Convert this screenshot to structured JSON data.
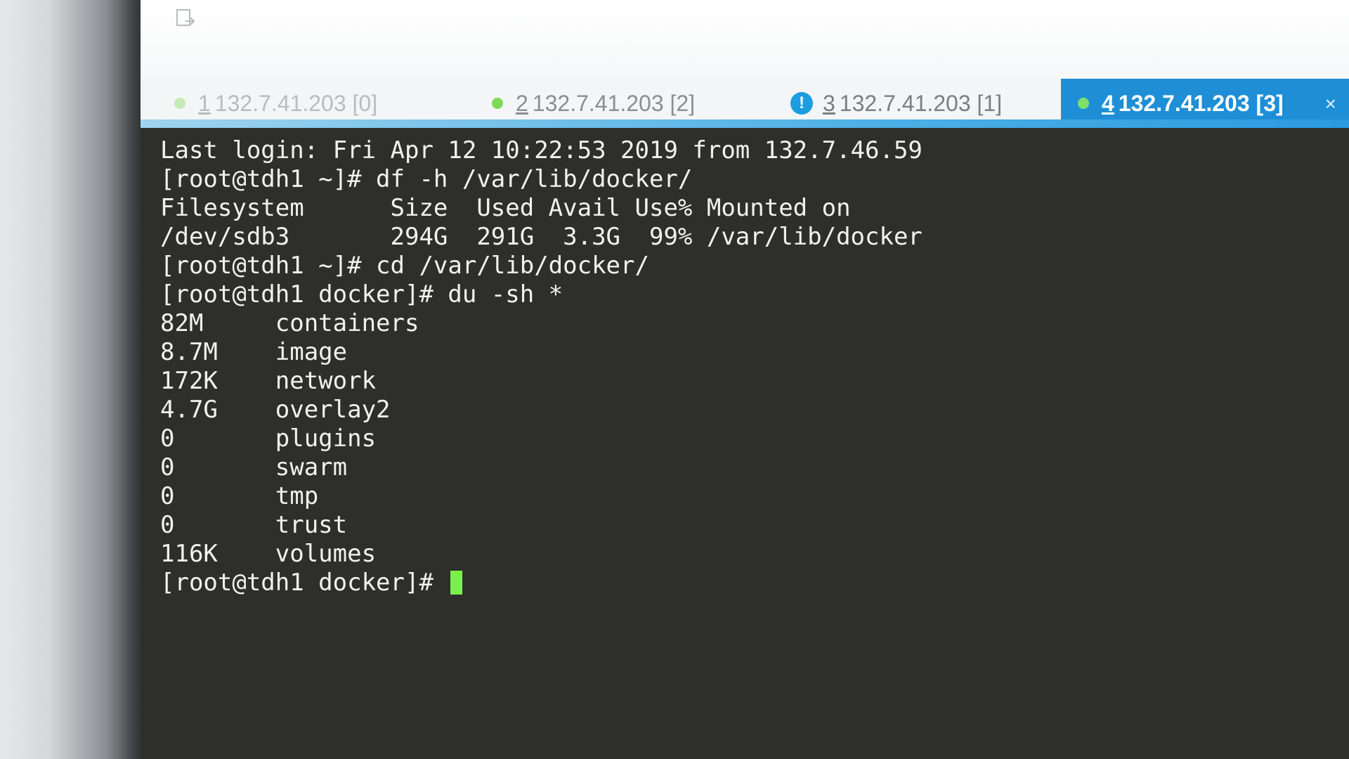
{
  "tabs": [
    {
      "num": "1",
      "label": "132.7.41.203 [0]",
      "status": "connected"
    },
    {
      "num": "2",
      "label": "132.7.41.203 [2]",
      "status": "connected"
    },
    {
      "num": "3",
      "label": "132.7.41.203 [1]",
      "status": "warning"
    },
    {
      "num": "4",
      "label": "132.7.41.203 [3]",
      "status": "connected",
      "active": true,
      "close": "×"
    }
  ],
  "terminal": {
    "lines": [
      "Last login: Fri Apr 12 10:22:53 2019 from 132.7.46.59",
      "[root@tdh1 ~]# df -h /var/lib/docker/",
      "Filesystem      Size  Used Avail Use% Mounted on",
      "/dev/sdb3       294G  291G  3.3G  99% /var/lib/docker",
      "[root@tdh1 ~]# cd /var/lib/docker/",
      "[root@tdh1 docker]# du -sh *",
      "82M     containers",
      "8.7M    image",
      "172K    network",
      "4.7G    overlay2",
      "0       plugins",
      "0       swarm",
      "0       tmp",
      "0       trust",
      "116K    volumes"
    ],
    "prompt": "[root@tdh1 docker]# "
  },
  "colors": {
    "terminal_bg": "#2e2f2c",
    "terminal_fg": "#f2f2ec",
    "cursor": "#7cf04a",
    "active_tab": "#1e8fd6",
    "status_dot": "#7ed957",
    "warning_icon": "#1c9de0"
  },
  "icons": {
    "toolbar": "session-icon",
    "warning": "exclamation-icon",
    "close": "close-icon"
  }
}
